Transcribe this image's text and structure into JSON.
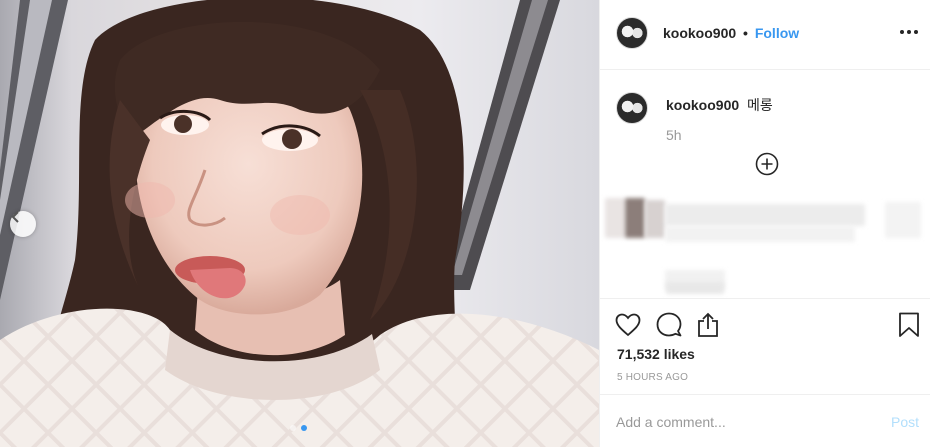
{
  "post": {
    "username": "kookoo900",
    "follow_label": "Follow",
    "separator": "•",
    "caption_text": "메롱",
    "caption_age": "5h",
    "likes": "71,532 likes",
    "posted_ago": "5 HOURS AGO"
  },
  "comment": {
    "placeholder": "Add a comment...",
    "post_label": "Post"
  },
  "carousel": {
    "slides": 2,
    "current_slide": 2
  },
  "icons": {
    "more": "more-options-icon",
    "prev": "chevron-left-icon",
    "expand": "plus-circle-icon",
    "like": "heart-icon",
    "comment": "comment-icon",
    "share": "share-icon",
    "save": "bookmark-icon"
  },
  "colors": {
    "accent": "#3897f0",
    "post_disabled": "#b2dffc",
    "muted": "#999999",
    "divider": "#efefef"
  }
}
